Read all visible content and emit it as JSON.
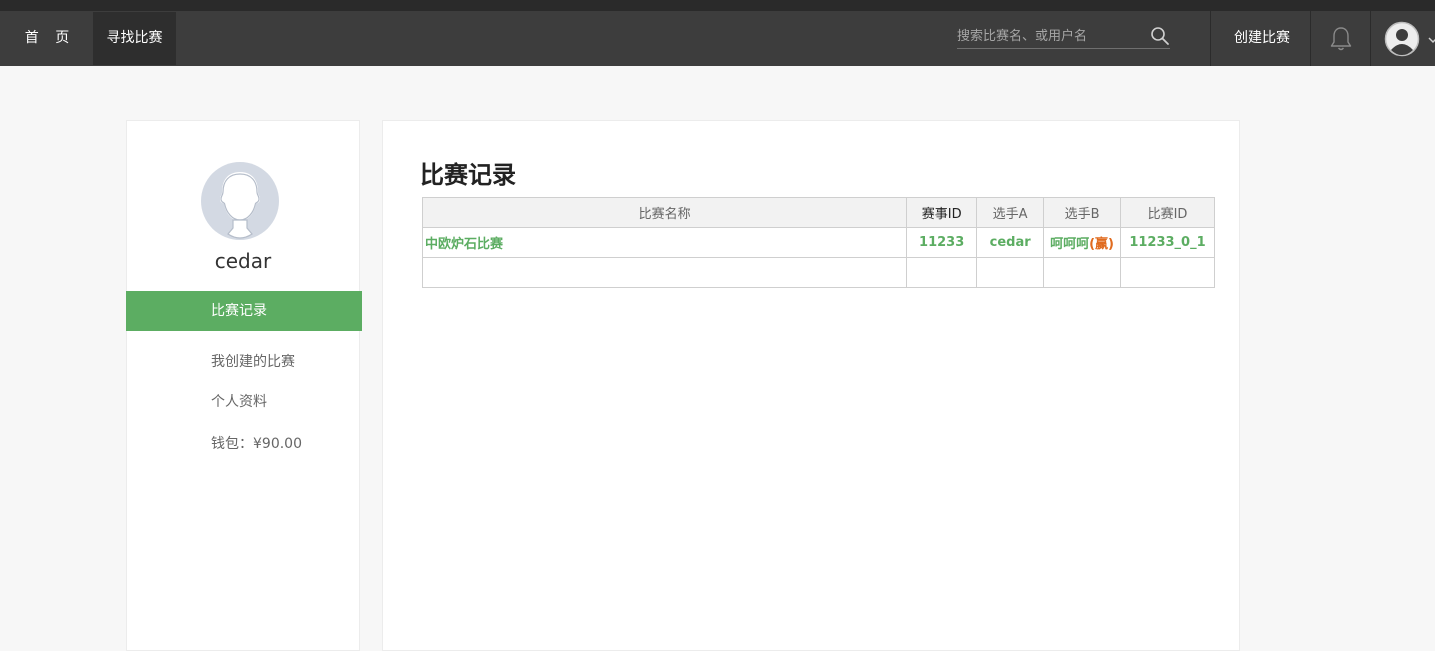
{
  "nav": {
    "home": "首 页",
    "find": "寻找比赛",
    "search_placeholder": "搜索比赛名、或用户名",
    "create": "创建比赛"
  },
  "sidebar": {
    "username": "cedar",
    "active_item": "比赛记录",
    "items": [
      "我创建的比赛",
      "个人资料"
    ],
    "wallet": "钱包：¥90.00"
  },
  "main": {
    "title": "比赛记录",
    "table": {
      "headers": [
        "比赛名称",
        "赛事ID",
        "选手A",
        "选手B",
        "比赛ID"
      ],
      "rows": [
        {
          "name": "中欧炉石比赛",
          "event_id": "11233",
          "player_a": "cedar",
          "player_b": "呵呵呵",
          "winner_mark": "(赢)",
          "match_id": "11233_0_1"
        }
      ]
    }
  },
  "colors": {
    "navbar": "#3d3d3d",
    "accent_green": "#5cad62",
    "win_orange": "#e06b1f"
  },
  "icons": [
    "search-icon",
    "bell-icon",
    "user-avatar-icon",
    "caret-down-icon"
  ]
}
